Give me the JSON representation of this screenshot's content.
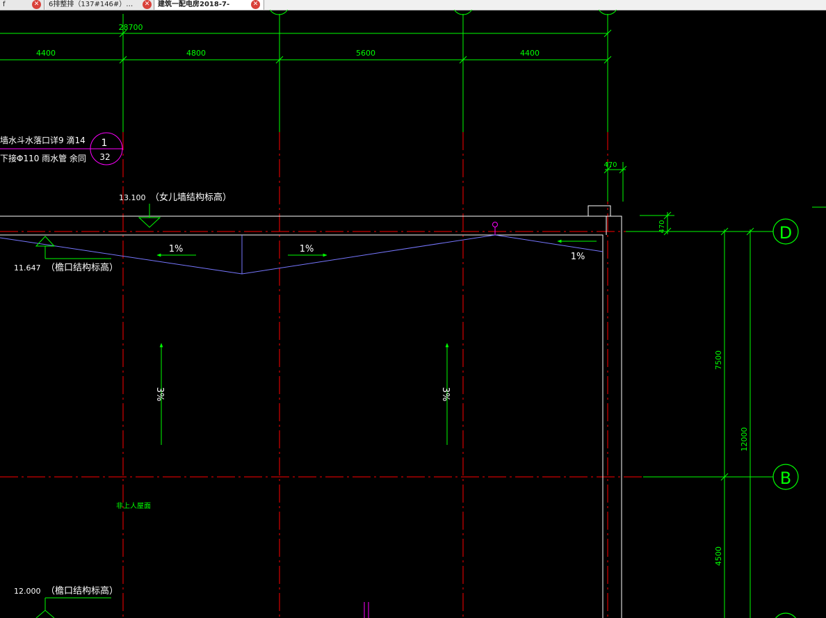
{
  "tabs": [
    {
      "label": "f",
      "close": "✕"
    },
    {
      "label": "6排整排（137#146#）…",
      "close": "✕"
    },
    {
      "label": "建筑一配电房2018-7-",
      "close": "✕"
    }
  ],
  "drawing": {
    "dims": {
      "total": "28700",
      "bay1": "4400",
      "bay2": "4800",
      "bay3": "5600",
      "bay4": "4400",
      "offset_top": "470",
      "offset_right": "470",
      "vertical_1": "7500",
      "vertical_total": "12000",
      "vertical_2": "4500"
    },
    "axes": {
      "d": "D",
      "b": "B"
    },
    "detail_ref": {
      "top": "1",
      "bottom": "32"
    },
    "notes": {
      "line1": "墙水斗水落口详9 滴14",
      "line2": "下接Φ110 雨水管 余同"
    },
    "elevations": {
      "parapet_value": "13.100",
      "parapet_label": "（女儿墙结构标高）",
      "eave1_value": "11.647",
      "eave1_label": "（檐口结构标高）",
      "eave2_value": "12.000",
      "eave2_label": "（檐口结构标高）"
    },
    "slopes": {
      "s1": "1%",
      "s2": "1%",
      "s3": "1%",
      "s4": "3%",
      "s5": "3%"
    },
    "roof_note": "非上人屋面",
    "colors": {
      "axis": "#ff0000",
      "dimension": "#00ff00",
      "wall": "#ffffff",
      "ridge": "#7777ff",
      "tag": "#ff00ff"
    }
  }
}
